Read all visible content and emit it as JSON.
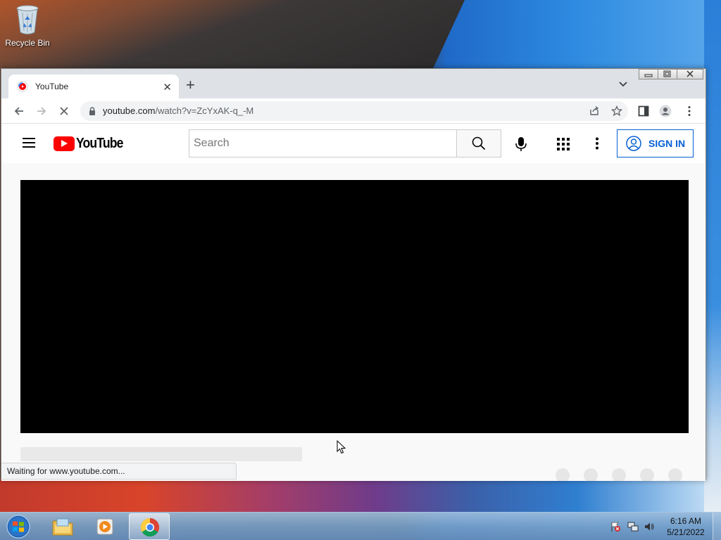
{
  "desktop": {
    "recycle_bin_label": "Recycle Bin"
  },
  "browser": {
    "tab": {
      "title": "YouTube",
      "close_glyph": "✕"
    },
    "new_tab_glyph": "+",
    "address_bar": {
      "host": "youtube.com",
      "path": "/watch?v=ZcYxAK-q_-M"
    },
    "status_text": "Waiting for www.youtube.com..."
  },
  "youtube": {
    "logo_text": "YouTube",
    "search": {
      "placeholder": "Search",
      "value": ""
    },
    "sign_in_label": "SIGN IN",
    "colors": {
      "brand_red": "#ff0000",
      "sign_in_blue": "#065fd4"
    }
  },
  "taskbar": {
    "clock": {
      "time": "6:16 AM",
      "date": "5/21/2022"
    }
  },
  "icons": [
    "recycle-bin-icon",
    "youtube-favicon",
    "close-icon",
    "plus-icon",
    "chevron-down-icon",
    "minimize-icon",
    "maximize-icon",
    "window-close-icon",
    "back-arrow-icon",
    "forward-arrow-icon",
    "reload-stop-icon",
    "lock-icon",
    "share-icon",
    "star-icon",
    "side-panel-icon",
    "profile-icon",
    "kebab-menu-icon",
    "hamburger-icon",
    "search-icon",
    "microphone-icon",
    "apps-grid-icon",
    "more-vert-icon",
    "account-circle-icon",
    "start-orb-icon",
    "file-explorer-icon",
    "media-player-icon",
    "chrome-icon",
    "action-center-flag-icon",
    "network-icon",
    "volume-icon"
  ]
}
